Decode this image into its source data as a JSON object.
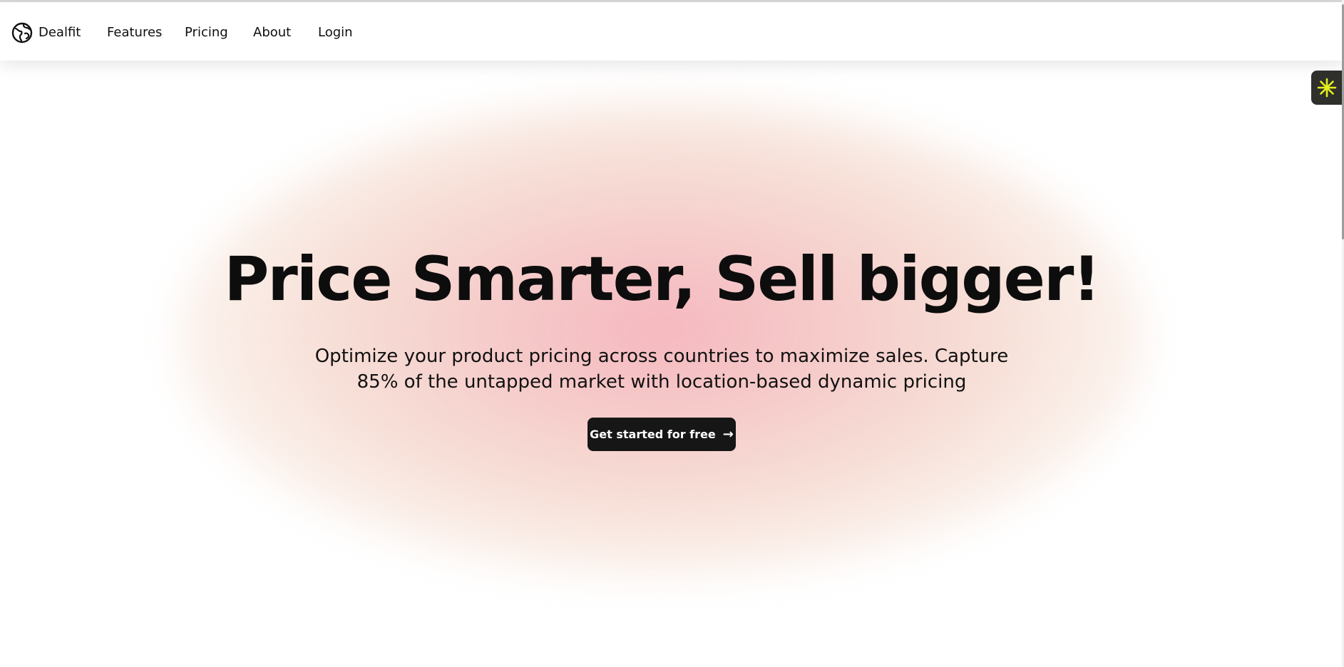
{
  "nav": {
    "brand_name": "Dealfit",
    "brand_icon": "globe-logo-icon",
    "links": [
      {
        "label": "Features"
      },
      {
        "label": "Pricing"
      },
      {
        "label": "About"
      },
      {
        "label": "Login"
      }
    ]
  },
  "hero": {
    "title": "Price Smarter, Sell bigger!",
    "subtitle": "Optimize your product pricing across countries to maximize sales. Capture 85% of the untapped market with location-based dynamic pricing",
    "cta_label": "Get started for free",
    "cta_icon": "arrow-right-icon"
  },
  "widget": {
    "icon": "asterisk-icon",
    "icon_color": "#e6f01e"
  },
  "colors": {
    "text": "#0d0d0d",
    "button_bg": "#161616",
    "button_text": "#ffffff",
    "glow_center": "#f5b7be",
    "glow_edge": "#f6e0d4"
  }
}
